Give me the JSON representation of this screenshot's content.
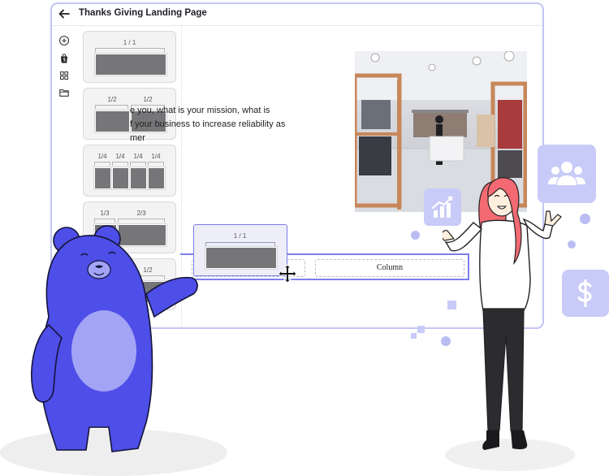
{
  "window": {
    "title": "Thanks Giving Landing Page"
  },
  "rail": {
    "icons": [
      "add-circle-icon",
      "shopify-bag-icon",
      "grid-icon",
      "folder-icon"
    ]
  },
  "layouts": [
    {
      "labels": [
        "1 / 1"
      ]
    },
    {
      "labels": [
        "1/2",
        "1/2"
      ]
    },
    {
      "labels": [
        "1/4",
        "1/4",
        "1/4",
        "1/4"
      ]
    },
    {
      "labels": [
        "1/3",
        "2/3"
      ]
    },
    {
      "labels": [
        "1/2"
      ]
    }
  ],
  "content": {
    "line1": "e you, what is your mission, what is",
    "line2": "f your business to increase reliability as",
    "line3": "mer"
  },
  "row": {
    "column_label": "Column"
  },
  "drag_card": {
    "label": "1 / 1"
  },
  "colors": {
    "accent": "#7c7fea",
    "window_border": "#c3c6f4",
    "bear": "#4e4ee8",
    "bear_belly": "#a3a4f5",
    "badge": "#c8cbf7"
  }
}
